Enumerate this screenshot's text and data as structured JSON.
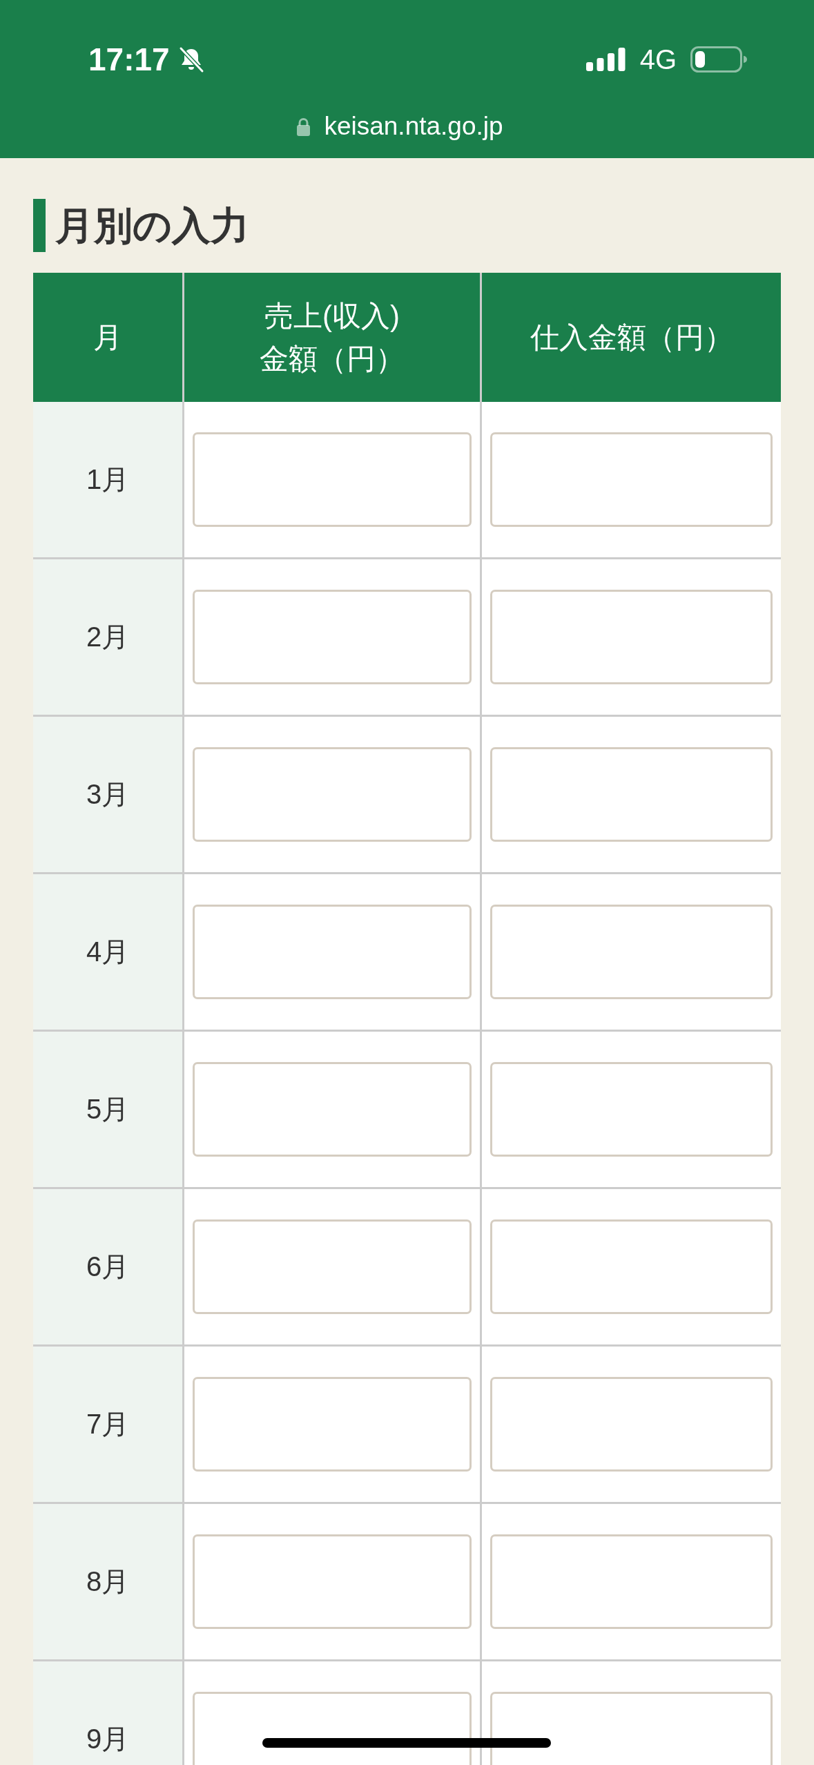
{
  "status_bar": {
    "time": "17:17",
    "network": "4G"
  },
  "address_bar": {
    "url": "keisan.nta.go.jp"
  },
  "section": {
    "title": "月別の入力"
  },
  "table": {
    "columns": [
      {
        "label": "月"
      },
      {
        "label": "売上(収入)\n金額（円）"
      },
      {
        "label": "仕入金額（円）"
      }
    ],
    "rows": [
      {
        "month": "1月"
      },
      {
        "month": "2月"
      },
      {
        "month": "3月"
      },
      {
        "month": "4月"
      },
      {
        "month": "5月"
      },
      {
        "month": "6月"
      },
      {
        "month": "7月"
      },
      {
        "month": "8月"
      },
      {
        "month": "9月"
      }
    ]
  }
}
